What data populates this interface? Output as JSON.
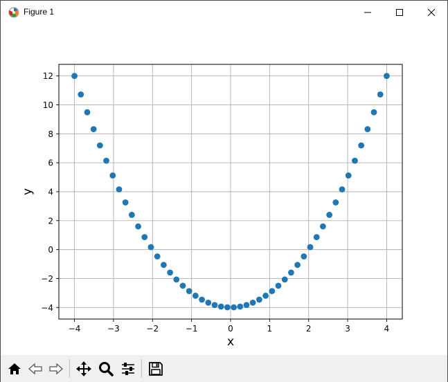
{
  "window": {
    "title": "Figure 1"
  },
  "toolbar": {
    "buttons": [
      {
        "name": "home",
        "icon": "home-icon"
      },
      {
        "name": "back",
        "icon": "back-arrow-icon"
      },
      {
        "name": "forward",
        "icon": "forward-arrow-icon"
      },
      {
        "name": "pan",
        "icon": "move-icon"
      },
      {
        "name": "zoom",
        "icon": "magnifier-icon"
      },
      {
        "name": "configure-subplots",
        "icon": "sliders-icon"
      },
      {
        "name": "save",
        "icon": "floppy-disk-icon"
      }
    ]
  },
  "chart_data": {
    "type": "scatter",
    "title": "",
    "xlabel": "x",
    "ylabel": "y",
    "xlim": [
      -4.4,
      4.4
    ],
    "ylim": [
      -4.8,
      12.8
    ],
    "xticks": [
      -4,
      -3,
      -2,
      -1,
      0,
      1,
      2,
      3,
      4
    ],
    "xtick_labels": [
      "−4",
      "−3",
      "−2",
      "−1",
      "0",
      "1",
      "2",
      "3",
      "4"
    ],
    "yticks": [
      -4,
      -2,
      0,
      2,
      4,
      6,
      8,
      10,
      12
    ],
    "ytick_labels": [
      "−4",
      "−2",
      "0",
      "2",
      "4",
      "6",
      "8",
      "10",
      "12"
    ],
    "grid": true,
    "marker_color": "#1f77b4",
    "series": [
      {
        "x": [
          -4.0,
          -3.837,
          -3.673,
          -3.51,
          -3.347,
          -3.184,
          -3.02,
          -2.857,
          -2.694,
          -2.531,
          -2.367,
          -2.204,
          -2.041,
          -1.878,
          -1.714,
          -1.551,
          -1.388,
          -1.224,
          -1.061,
          -0.898,
          -0.735,
          -0.571,
          -0.408,
          -0.245,
          -0.082,
          0.082,
          0.245,
          0.408,
          0.571,
          0.735,
          0.898,
          1.061,
          1.224,
          1.388,
          1.551,
          1.714,
          1.878,
          2.041,
          2.204,
          2.367,
          2.531,
          2.694,
          2.857,
          3.02,
          3.184,
          3.347,
          3.51,
          3.673,
          3.837,
          4.0
        ],
        "y": [
          12.0,
          10.72,
          9.49,
          8.32,
          7.2,
          6.14,
          5.12,
          4.16,
          3.26,
          2.4,
          1.6,
          0.86,
          0.17,
          -0.47,
          -1.06,
          -1.59,
          -2.07,
          -2.5,
          -2.87,
          -3.19,
          -3.46,
          -3.67,
          -3.83,
          -3.94,
          -3.99,
          -3.99,
          -3.94,
          -3.83,
          -3.67,
          -3.46,
          -3.19,
          -2.87,
          -2.5,
          -2.07,
          -1.59,
          -1.06,
          -0.47,
          0.17,
          0.86,
          1.6,
          2.4,
          3.26,
          4.16,
          5.12,
          6.14,
          7.2,
          8.32,
          9.49,
          10.72,
          12.0
        ]
      }
    ]
  }
}
